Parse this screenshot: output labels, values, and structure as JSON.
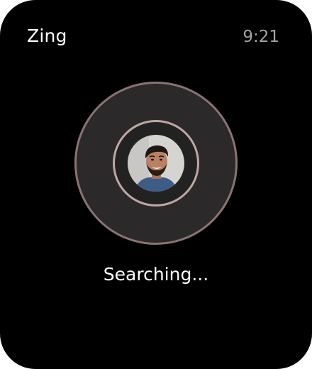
{
  "header": {
    "app_name": "Zing",
    "time": "9:21"
  },
  "status": {
    "text": "Searching..."
  },
  "colors": {
    "background": "#000000",
    "outer_ring": "#8b7373",
    "inner_ring": "#bea7a5"
  }
}
